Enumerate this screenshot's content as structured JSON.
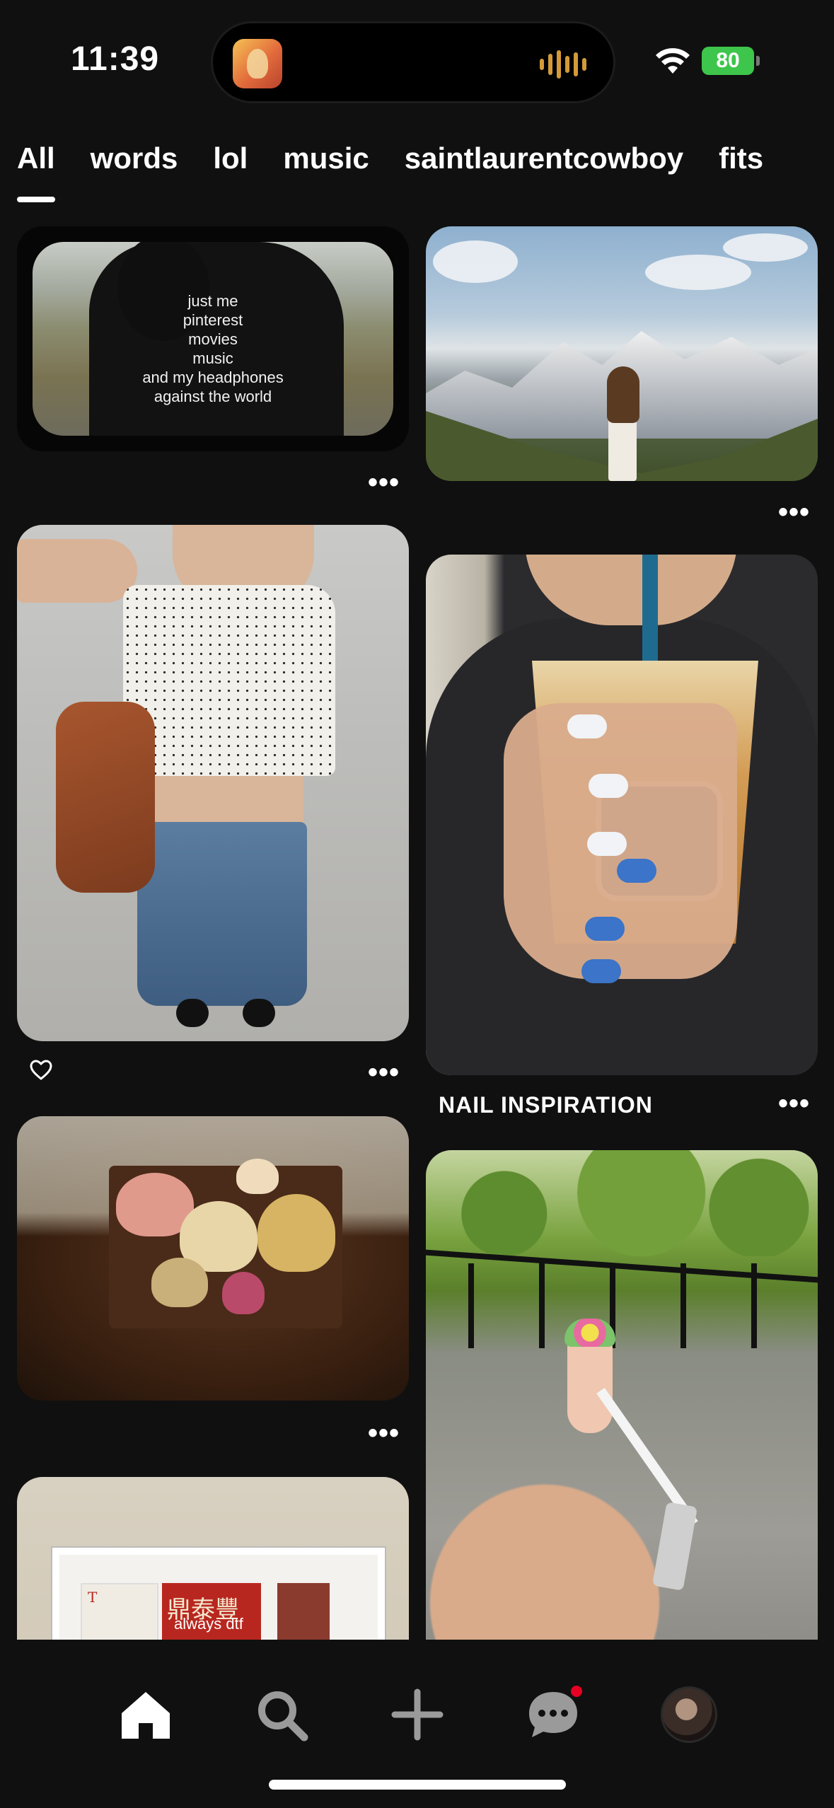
{
  "status_bar": {
    "time": "11:39",
    "battery": "80"
  },
  "tabs": [
    {
      "label": "All",
      "active": true
    },
    {
      "label": "words",
      "active": false
    },
    {
      "label": "lol",
      "active": false
    },
    {
      "label": "music",
      "active": false
    },
    {
      "label": "saintlaurentcowboy",
      "active": false
    },
    {
      "label": "fits",
      "active": false
    }
  ],
  "pins": {
    "pin1": {
      "caption_lines": [
        "just me",
        "pinterest",
        "movies",
        "music",
        "and my headphones",
        "against the world"
      ],
      "more_label": "•••"
    },
    "pin2": {
      "more_label": "•••"
    },
    "pin3": {
      "more_label": "•••",
      "liked_icon": "heart-outline-icon"
    },
    "pin4": {
      "title": "NAIL INSPIRATION",
      "more_label": "•••"
    },
    "pin5": {
      "more_label": "•••"
    },
    "pin7": {
      "frame_red_text": "鼎泰豐",
      "frame_caption": "always dtf",
      "frame_letter": "T"
    }
  },
  "bottom_nav": [
    {
      "name": "home",
      "icon": "home-icon",
      "active": true
    },
    {
      "name": "search",
      "icon": "search-icon"
    },
    {
      "name": "create",
      "icon": "plus-icon"
    },
    {
      "name": "messages",
      "icon": "chat-bubble-icon",
      "has_notification": true
    },
    {
      "name": "profile",
      "icon": "avatar"
    }
  ],
  "colors": {
    "background": "#101010",
    "notification_red": "#e60023",
    "battery_green": "#3ec54b",
    "text": "#ffffff"
  }
}
